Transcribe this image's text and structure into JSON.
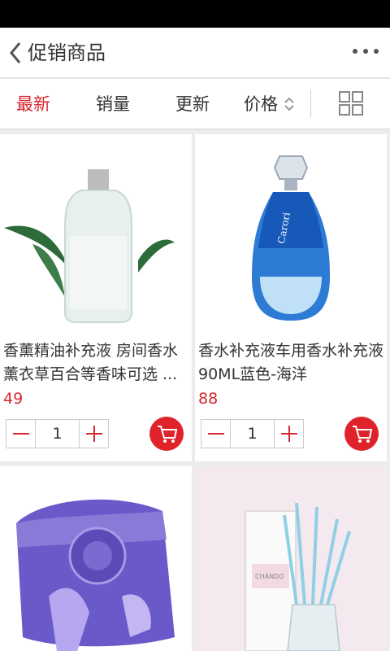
{
  "header": {
    "title": "促销商品"
  },
  "sortbar": {
    "items": [
      "最新",
      "销量",
      "更新",
      "价格"
    ],
    "active": "最新"
  },
  "products": [
    {
      "name": "香薰精油补充液 房间香水薰衣草百合等香味可选 ...",
      "price": "49",
      "qty": "1",
      "image": "oil-bottle-with-leaves"
    },
    {
      "name": "香水补充液车用香水补充液90ML蓝色-海洋",
      "price": "88",
      "qty": "1",
      "image": "blue-perfume-bottle"
    },
    {
      "name": "",
      "price": "",
      "qty": "",
      "image": "purple-sachet-with-rose"
    },
    {
      "name": "",
      "price": "",
      "qty": "",
      "image": "reed-diffuser-box"
    }
  ],
  "colors": {
    "accent": "#d9272e",
    "cart": "#e0232a",
    "background": "#ececec"
  },
  "icons": [
    "back-arrow-icon",
    "more-dots-icon",
    "sort-arrows-icon",
    "grid-view-icon",
    "minus-icon",
    "plus-icon",
    "cart-icon"
  ]
}
